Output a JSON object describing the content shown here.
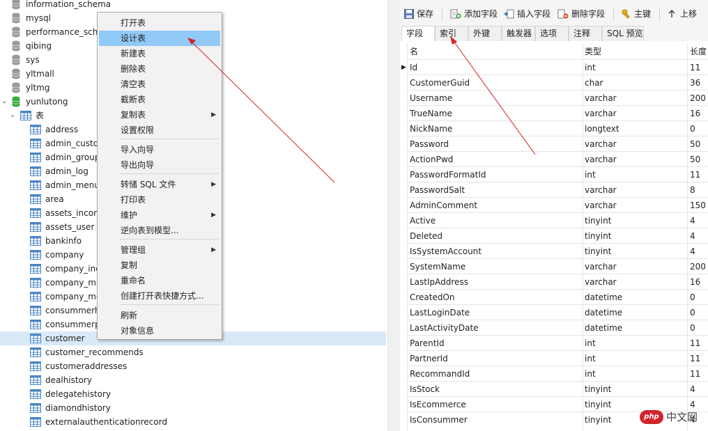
{
  "tree": {
    "databases_top": [
      {
        "label": "information_schema"
      },
      {
        "label": "mysql"
      },
      {
        "label": "performance_sche"
      },
      {
        "label": "qibing"
      },
      {
        "label": "sys"
      },
      {
        "label": "yltmall"
      },
      {
        "label": "yltmg"
      },
      {
        "label": "yunlutong"
      }
    ],
    "tables_group": {
      "label": "表"
    },
    "tables": [
      {
        "label": "address"
      },
      {
        "label": "admin_custor"
      },
      {
        "label": "admin_group"
      },
      {
        "label": "admin_log"
      },
      {
        "label": "admin_menu"
      },
      {
        "label": "area"
      },
      {
        "label": "assets_incom"
      },
      {
        "label": "assets_user"
      },
      {
        "label": "bankinfo"
      },
      {
        "label": "company"
      },
      {
        "label": "company_inc"
      },
      {
        "label": "company_ma"
      },
      {
        "label": "company_mo"
      },
      {
        "label": "consummerh"
      },
      {
        "label": "consummerp"
      },
      {
        "label": "customer"
      },
      {
        "label": "customer_recommends"
      },
      {
        "label": "customeraddresses"
      },
      {
        "label": "dealhistory"
      },
      {
        "label": "delegatehistory"
      },
      {
        "label": "diamondhistory"
      },
      {
        "label": "externalauthenticationrecord"
      }
    ],
    "selected_table": "customer"
  },
  "context_menu": {
    "items": [
      {
        "label": "打开表"
      },
      {
        "label": "设计表",
        "highlighted": true
      },
      {
        "label": "新建表"
      },
      {
        "label": "删除表"
      },
      {
        "label": "清空表"
      },
      {
        "label": "截断表"
      },
      {
        "label": "复制表",
        "submenu": true
      },
      {
        "label": "设置权限"
      },
      {
        "label": "导入向导"
      },
      {
        "label": "导出向导"
      },
      {
        "label": "转储 SQL 文件",
        "submenu": true
      },
      {
        "label": "打印表"
      },
      {
        "label": "维护",
        "submenu": true
      },
      {
        "label": "逆向表到模型..."
      },
      {
        "label": "管理组",
        "submenu": true
      },
      {
        "label": "复制"
      },
      {
        "label": "重命名"
      },
      {
        "label": "创建打开表快捷方式..."
      },
      {
        "label": "刷新"
      },
      {
        "label": "对象信息"
      }
    ]
  },
  "toolbar": {
    "save": "保存",
    "add_field": "添加字段",
    "insert_field": "插入字段",
    "delete_field": "删除字段",
    "primary_key": "主键",
    "move_up": "上移"
  },
  "tabs": [
    {
      "label": "字段",
      "active": true
    },
    {
      "label": "索引"
    },
    {
      "label": "外键"
    },
    {
      "label": "触发器"
    },
    {
      "label": "选项"
    },
    {
      "label": "注释"
    },
    {
      "label": "SQL 预览"
    }
  ],
  "grid": {
    "headers": {
      "name": "名",
      "type": "类型",
      "length": "长度"
    },
    "rows": [
      {
        "name": "Id",
        "type": "int",
        "length": "11"
      },
      {
        "name": "CustomerGuid",
        "type": "char",
        "length": "36"
      },
      {
        "name": "Username",
        "type": "varchar",
        "length": "200"
      },
      {
        "name": "TrueName",
        "type": "varchar",
        "length": "16"
      },
      {
        "name": "NickName",
        "type": "longtext",
        "length": "0"
      },
      {
        "name": "Password",
        "type": "varchar",
        "length": "50"
      },
      {
        "name": "ActionPwd",
        "type": "varchar",
        "length": "50"
      },
      {
        "name": "PasswordFormatId",
        "type": "int",
        "length": "11"
      },
      {
        "name": "PasswordSalt",
        "type": "varchar",
        "length": "8"
      },
      {
        "name": "AdminComment",
        "type": "varchar",
        "length": "150"
      },
      {
        "name": "Active",
        "type": "tinyint",
        "length": "4"
      },
      {
        "name": "Deleted",
        "type": "tinyint",
        "length": "4"
      },
      {
        "name": "IsSystemAccount",
        "type": "tinyint",
        "length": "4"
      },
      {
        "name": "SystemName",
        "type": "varchar",
        "length": "200"
      },
      {
        "name": "LastIpAddress",
        "type": "varchar",
        "length": "16"
      },
      {
        "name": "CreatedOn",
        "type": "datetime",
        "length": "0"
      },
      {
        "name": "LastLoginDate",
        "type": "datetime",
        "length": "0"
      },
      {
        "name": "LastActivityDate",
        "type": "datetime",
        "length": "0"
      },
      {
        "name": "ParentId",
        "type": "int",
        "length": "11"
      },
      {
        "name": "PartnerId",
        "type": "int",
        "length": "11"
      },
      {
        "name": "RecommandId",
        "type": "int",
        "length": "11"
      },
      {
        "name": "IsStock",
        "type": "tinyint",
        "length": "4"
      },
      {
        "name": "IsEcommerce",
        "type": "tinyint",
        "length": "4"
      },
      {
        "name": "IsConsummer",
        "type": "tinyint",
        "length": "4"
      }
    ]
  },
  "watermark": {
    "logo": "php",
    "text": "中文网"
  },
  "colors": {
    "menu_highlight": "#91c9f7",
    "selected_row": "#d9e9f8",
    "annotation_arrow": "#d42020",
    "db_active": "#3cab3c"
  }
}
